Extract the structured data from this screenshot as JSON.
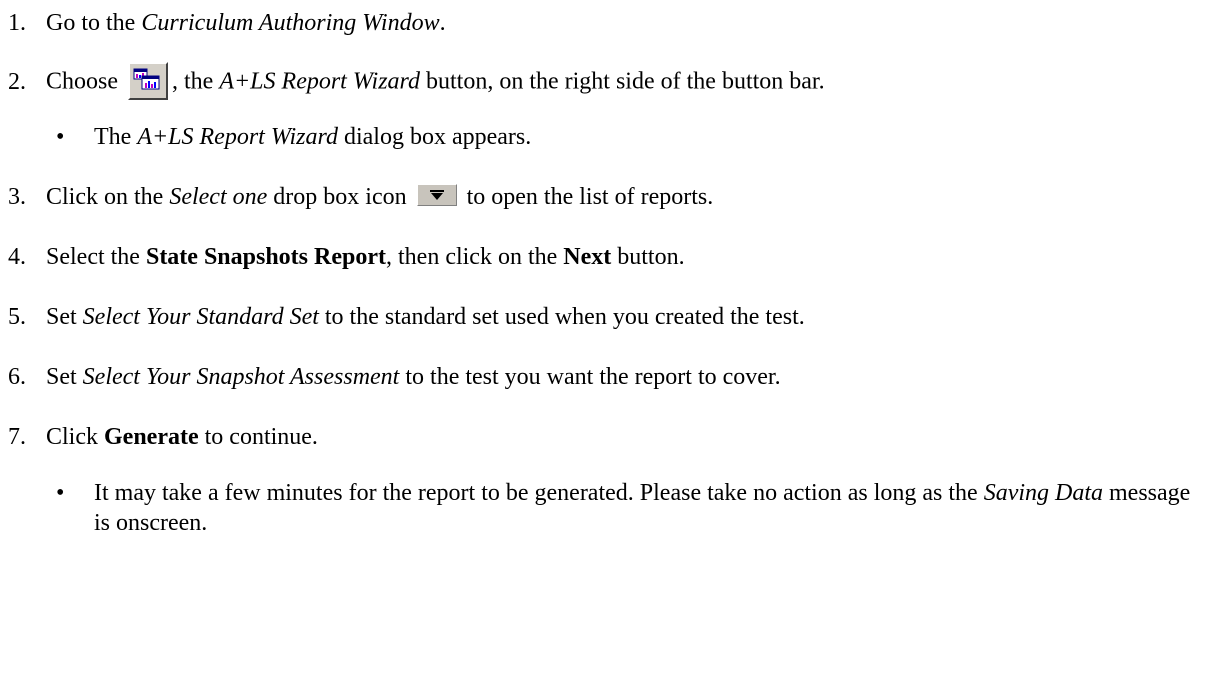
{
  "steps": [
    {
      "num": "1.",
      "parts": [
        {
          "t": "Go to the "
        },
        {
          "t": "Curriculum Authoring Window",
          "s": "i"
        },
        {
          "t": "."
        }
      ]
    },
    {
      "num": "2.",
      "parts": [
        {
          "t": "Choose "
        },
        {
          "icon": "wizard"
        },
        {
          "t": ", the "
        },
        {
          "t": "A+LS Report Wizard",
          "s": "i"
        },
        {
          "t": " button, on the right side of the button bar."
        }
      ]
    },
    {
      "num": "3.",
      "parts": [
        {
          "t": "Click on the "
        },
        {
          "t": "Select one",
          "s": "i"
        },
        {
          "t": " drop box icon "
        },
        {
          "icon": "dropdown"
        },
        {
          "t": " to open the list of reports."
        }
      ]
    },
    {
      "num": "4.",
      "parts": [
        {
          "t": "Select the "
        },
        {
          "t": "State Snapshots Report",
          "s": "b"
        },
        {
          "t": ", then click on the "
        },
        {
          "t": "Next",
          "s": "b"
        },
        {
          "t": " button."
        }
      ]
    },
    {
      "num": "5.",
      "parts": [
        {
          "t": "Set "
        },
        {
          "t": "Select Your Standard Set",
          "s": "i"
        },
        {
          "t": " to the standard set used when you created the test."
        }
      ]
    },
    {
      "num": "6.",
      "parts": [
        {
          "t": "Set "
        },
        {
          "t": "Select Your Snapshot Assessment",
          "s": "i"
        },
        {
          "t": " to the test you want the report to cover."
        }
      ]
    },
    {
      "num": "7.",
      "parts": [
        {
          "t": "Click "
        },
        {
          "t": "Generate",
          "s": "b"
        },
        {
          "t": " to continue."
        }
      ]
    }
  ],
  "subs": [
    {
      "after": "2.",
      "parts": [
        {
          "t": "The "
        },
        {
          "t": "A+LS Report Wizard",
          "s": "i"
        },
        {
          "t": " dialog box appears."
        }
      ]
    },
    {
      "after": "7.",
      "parts": [
        {
          "t": "It may take a few minutes for the report to be generated.  Please take no action as long as the "
        },
        {
          "t": "Saving Data",
          "s": "i"
        },
        {
          "t": " message is onscreen."
        }
      ]
    }
  ],
  "bullet_char": "•",
  "icons": {
    "wizard": "report-wizard-icon",
    "dropdown": "dropdown-arrow-icon"
  },
  "colors": {
    "wizard_face": "#d4d0c8",
    "dropdown_face": "#c8c4bc",
    "text": "#000000"
  }
}
